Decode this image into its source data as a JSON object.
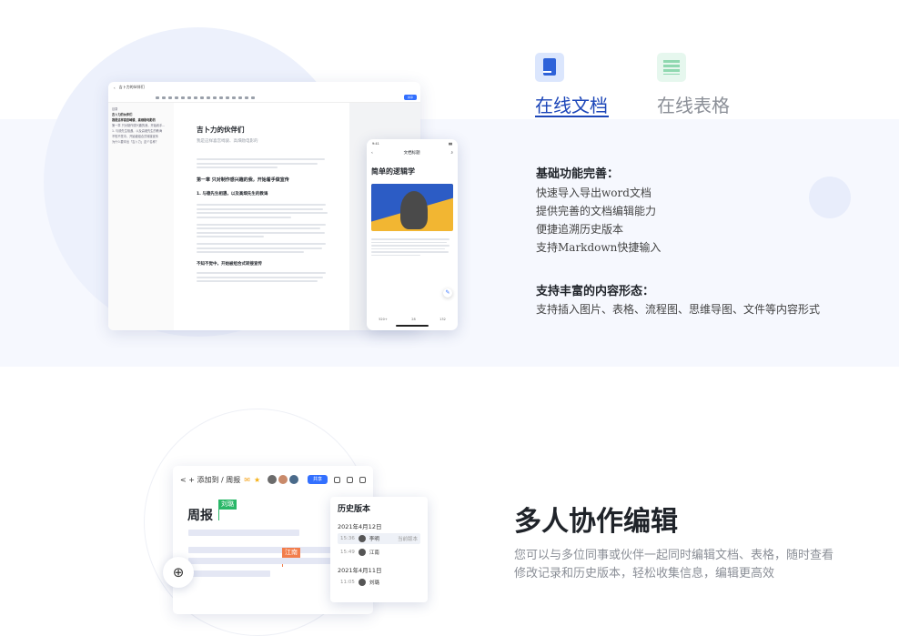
{
  "tabs": [
    {
      "label": "在线文档",
      "active": true,
      "icon": "doc-icon",
      "color": "#1c46b8"
    },
    {
      "label": "在线表格",
      "active": false,
      "icon": "sheet-icon",
      "color": "#8b8f97"
    }
  ],
  "features": {
    "basic_title": "基础功能完善：",
    "basic_items": [
      "快速导入导出word文档",
      "提供完善的文档编辑能力",
      "便捷追溯历史版本",
      "支持Markdown快捷输入"
    ],
    "rich_title": "支持丰富的内容形态：",
    "rich_items": [
      "支持插入图片、表格、流程图、思维导图、文件等内容形式"
    ]
  },
  "desktop_mock": {
    "doc_title": "吉卜力的伙伴们",
    "doc_subtitle": "我是这样喜宫崎骏、高畑勋电影的",
    "chapter": "第一章 只对制作感兴趣的我，开始着手做宣传",
    "section": "1. 与德先生相遇，以及高畑先生的教诲",
    "section2": "不知不觉中，开始被组合式转接宣传",
    "toc_title": "目录",
    "toc_items": [
      "吉卜力的伙伴们",
      "我是这样喜宫崎骏、高畑勋电影的",
      "第一章 只对制作感兴趣的我，开始着手...",
      "1. 与德先生相遇，以及高畑先生的教诲",
      "不知不觉中，开始被组合式转接宣传",
      "为什么要拿出「吉卜力」这个名称？"
    ]
  },
  "phone_mock": {
    "time": "9:41",
    "nav_title": "文档标题",
    "heading": "简单的逻辑学",
    "stats": [
      "520+",
      "28",
      "132"
    ]
  },
  "collab": {
    "title": "多人协作编辑",
    "description": "您可以与多位同事或伙伴一起同时编辑文档、表格，随时查看修改记录和历史版本，轻松收集信息，编辑更高效"
  },
  "weekly_mock": {
    "breadcrumb": "< + 添加到 / 周报",
    "share": "共享",
    "title": "周报",
    "flag_a": "刘璐",
    "flag_b": "江南"
  },
  "history": {
    "title": "历史版本",
    "groups": [
      {
        "date": "2021年4月12日",
        "rows": [
          {
            "time": "15:36",
            "name": "李明",
            "tag": "当前版本",
            "selected": true
          },
          {
            "time": "15:49",
            "name": "江南",
            "tag": "",
            "selected": false
          }
        ]
      },
      {
        "date": "2021年4月11日",
        "rows": [
          {
            "time": "11:05",
            "name": "刘璐",
            "tag": "",
            "selected": false
          }
        ]
      }
    ]
  }
}
